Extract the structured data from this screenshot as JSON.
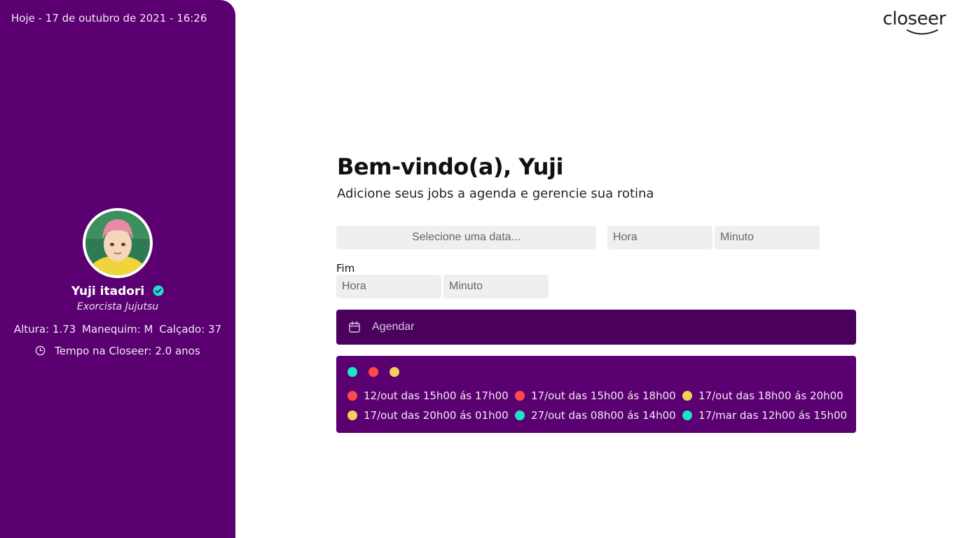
{
  "sidebar": {
    "date_text": "Hoje - 17 de outubro de 2021 - 16:26",
    "profile": {
      "name": "Yuji itadori",
      "role": "Exorcista Jujutsu",
      "height": "Altura: 1.73",
      "size": "Manequim: M",
      "shoe": "Calçado: 37",
      "tenure": "Tempo na Closeer: 2.0 anos"
    }
  },
  "brand": {
    "logo_text": "closeer"
  },
  "main": {
    "title": "Bem-vindo(a), Yuji",
    "subtitle": "Adicione seus jobs a agenda e gerencie sua rotina",
    "date_placeholder": "Selecione uma data...",
    "start_hour_placeholder": "Hora",
    "start_minute_placeholder": "Minuto",
    "end_label": "Fim",
    "end_hour_placeholder": "Hora",
    "end_minute_placeholder": "Minuto",
    "schedule_label": "Agendar"
  },
  "colors": {
    "sidebar_bg": "#5a0070",
    "button_bg": "#4b005e",
    "teal": "#19e6c8",
    "red": "#ff4a4a",
    "yellow": "#f2d05a"
  },
  "legend": [
    "teal",
    "red",
    "yellow"
  ],
  "jobs": [
    {
      "color": "red",
      "text": "12/out das 15h00 ás 17h00"
    },
    {
      "color": "red",
      "text": "17/out das 15h00 ás 18h00"
    },
    {
      "color": "yellow",
      "text": "17/out das 18h00 ás 20h00"
    },
    {
      "color": "yellow",
      "text": "17/out das 20h00 ás 01h00"
    },
    {
      "color": "teal",
      "text": "27/out das 08h00 ás 14h00"
    },
    {
      "color": "teal",
      "text": "17/mar das 12h00 ás 15h00"
    }
  ]
}
